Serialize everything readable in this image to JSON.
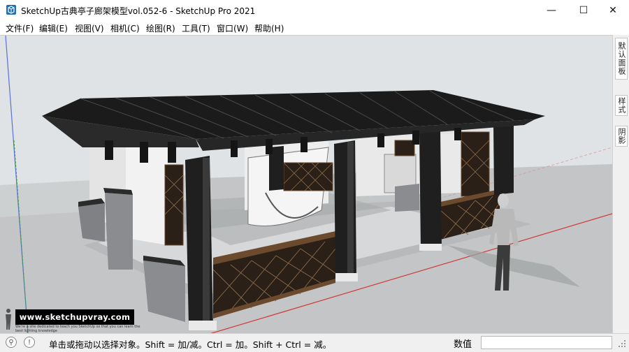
{
  "window": {
    "title": "SketchUp古典亭子廊架模型vol.052-6 - SketchUp Pro 2021",
    "minimize": "—",
    "maximize": "☐",
    "close": "✕"
  },
  "menu": {
    "items": [
      "文件(F)",
      "编辑(E)",
      "视图(V)",
      "相机(C)",
      "绘图(R)",
      "工具(T)",
      "窗口(W)",
      "帮助(H)"
    ]
  },
  "tray": {
    "tabs": [
      "默认面板",
      "样式",
      "阴影"
    ]
  },
  "viewport": {
    "watermark": "www.sketchupvray.com",
    "watermark_sub": "We're a site dedicated to teach you SketchUp so that you can learn the best lighting knowledge"
  },
  "status": {
    "hint": "单击或拖动以选择对象。Shift = 加/减。Ctrl = 加。Shift + Ctrl = 减。",
    "measurements_label": "数值",
    "measurements_value": "",
    "geo_icon": "geo-location-icon",
    "info_icon": "info-icon",
    "credits_icon": "credits-icon"
  },
  "colors": {
    "sky": "#dfe3e5",
    "ground": "#c4c6c7",
    "roof": "#1c1c1c",
    "wood": "#6b4a2e",
    "wall": "#ebebeb",
    "red_axis": "#d23a3a",
    "green_axis": "#3aa33a",
    "blue_axis": "#5a6fd8"
  }
}
